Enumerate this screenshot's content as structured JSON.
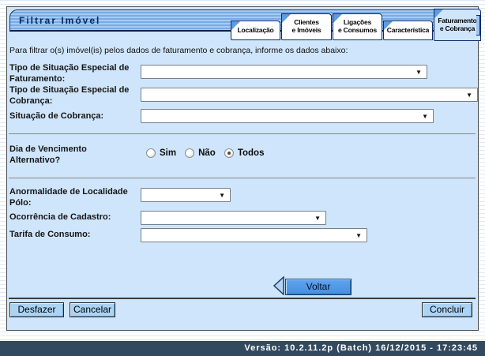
{
  "window": {
    "title": "Filtrar Imóvel"
  },
  "tabs": [
    {
      "label": "Localização"
    },
    {
      "label": "Clientes\ne Imóveis"
    },
    {
      "label": "Ligações\ne Consumos"
    },
    {
      "label": "Característica"
    },
    {
      "label": "Faturamento\ne Cobrança",
      "active": true
    }
  ],
  "form": {
    "intro": "Para filtrar o(s) imóvel(is) pelos dados de faturamento e cobrança, informe os dados abaixo:",
    "fields": [
      {
        "label": "Tipo de Situação Especial de Faturamento:",
        "value": ""
      },
      {
        "label": "Tipo de Situação Especial de Cobrança:",
        "value": ""
      },
      {
        "label": "Situação de Cobrança:",
        "value": ""
      },
      {
        "label": "Anormalidade de Localidade Pólo:",
        "value": ""
      },
      {
        "label": "Ocorrência de Cadastro:",
        "value": ""
      },
      {
        "label": "Tarifa de Consumo:",
        "value": ""
      }
    ],
    "radio_group": {
      "label": "Dia de Vencimento Alternativo?",
      "options": [
        "Sim",
        "Não",
        "Todos"
      ],
      "selected": "Todos"
    }
  },
  "buttons": {
    "voltar": "Voltar",
    "desfazer": "Desfazer",
    "cancelar": "Cancelar",
    "concluir": "Concluir"
  },
  "footer": {
    "version": "Versão: 10.2.11.2p (Batch) 16/12/2015 - 17:23:45"
  },
  "colors": {
    "titlebar_blue": "#77aae7",
    "content_bg": "#cfe5fb",
    "voltar_button": "#4690e2",
    "flat_button": "#abd3f4",
    "footer_bg": "#33495f",
    "tab_border": "#0d2a66"
  }
}
